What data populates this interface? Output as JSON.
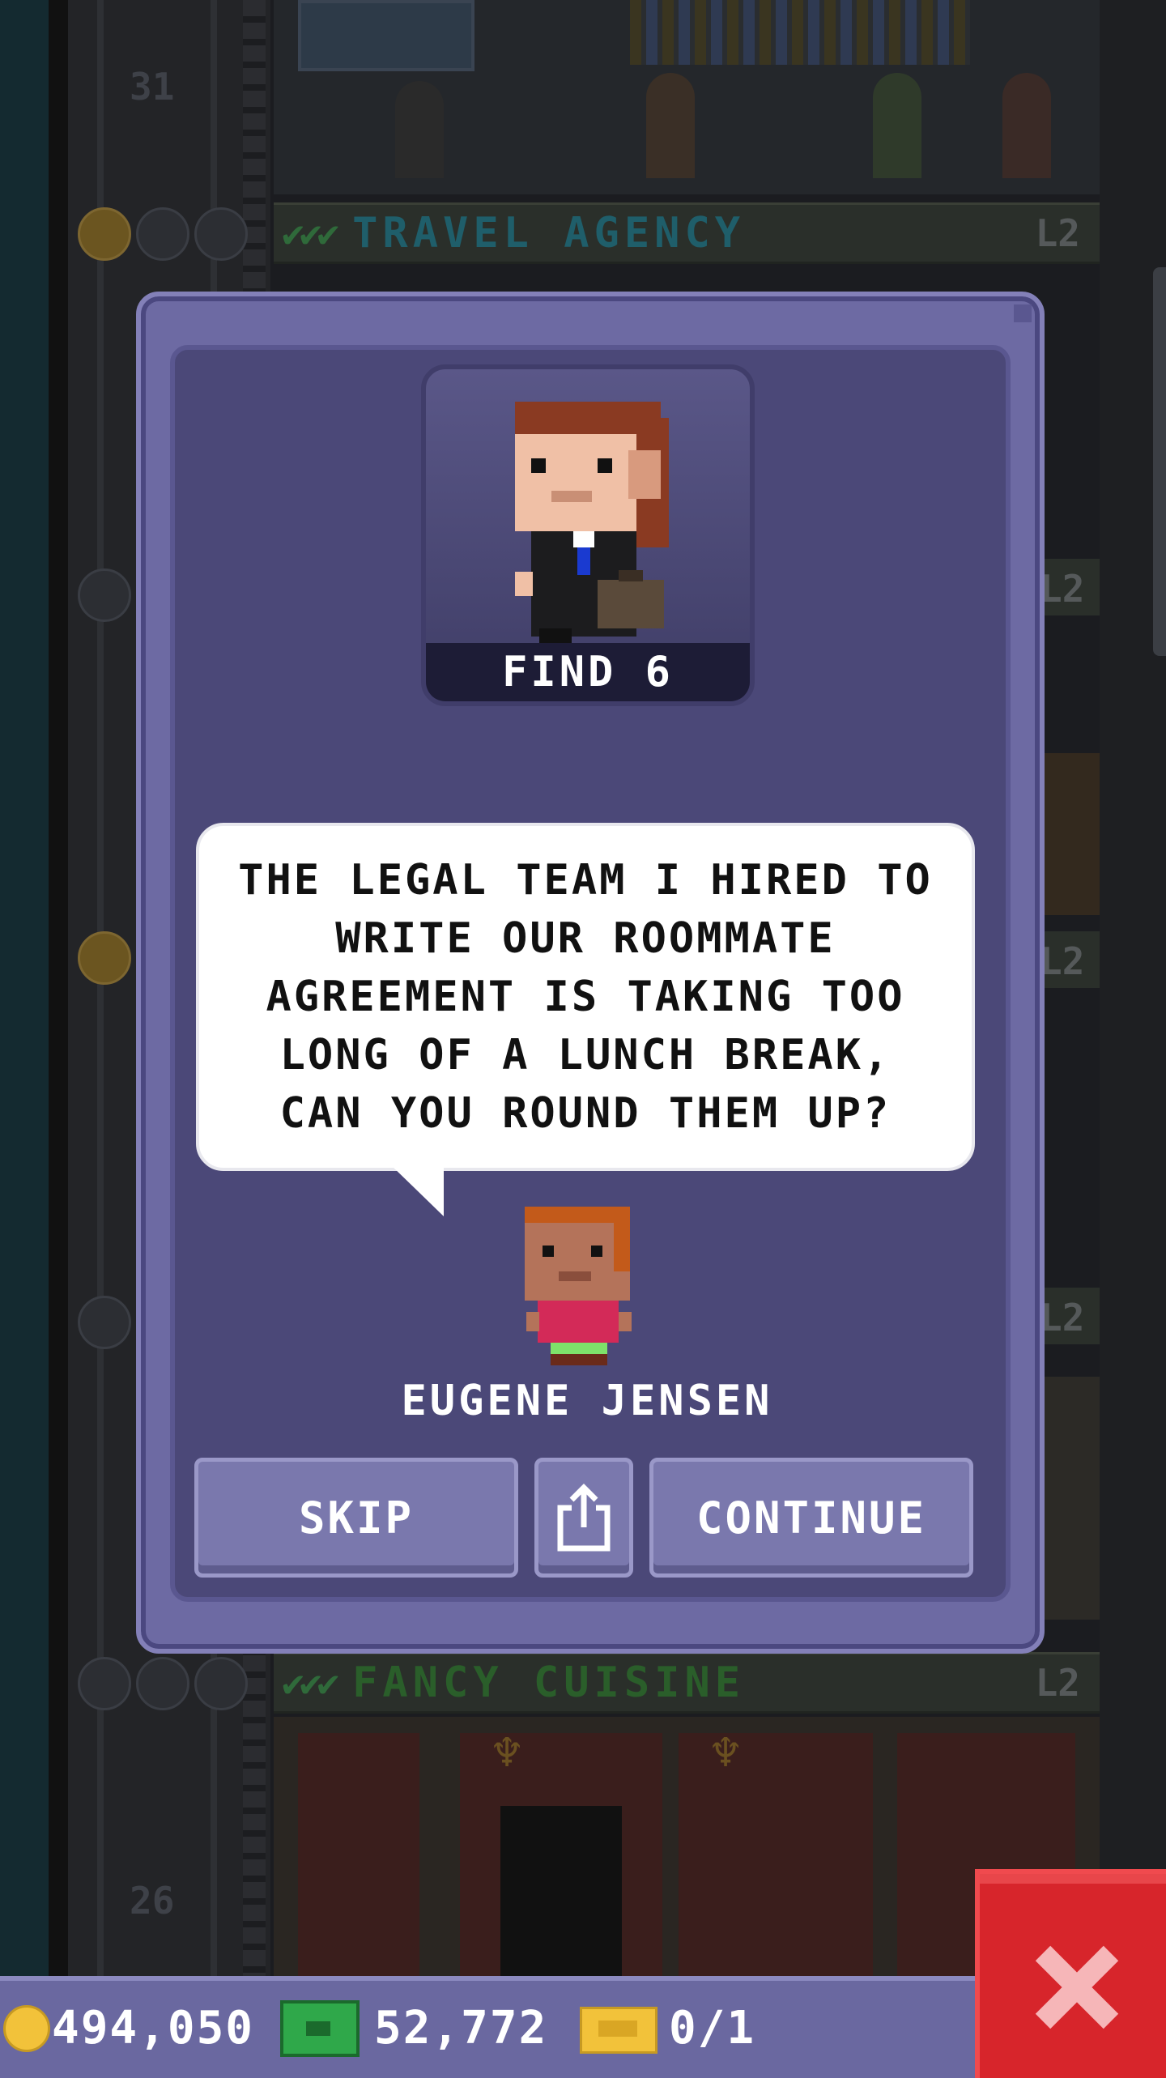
{
  "background": {
    "floors": [
      {
        "name": "TRAVEL AGENCY",
        "level": "L2",
        "number": "31"
      },
      {
        "name": "FANCY CUISINE",
        "level": "L2",
        "number": "26"
      }
    ],
    "side_levels": [
      "L2",
      "L2",
      "L2"
    ]
  },
  "dialog": {
    "portrait_label": "FIND 6",
    "message": "THE LEGAL TEAM I HIRED TO\nWRITE OUR ROOMMATE\nAGREEMENT IS TAKING TOO\nLONG OF A LUNCH BREAK,\nCAN YOU ROUND THEM UP?",
    "speaker_name": "EUGENE JENSEN",
    "buttons": {
      "skip": "SKIP",
      "share_icon": "share-icon",
      "continue": "CONTINUE"
    }
  },
  "status_bar": {
    "coins": "494,050",
    "bux": "52,772",
    "tickets": "0/1"
  },
  "colors": {
    "modal": "#6d6aa3",
    "modal_inner": "#4b4878",
    "button": "#7a78ad",
    "close": "#d7252b",
    "travel_agency": "#1f5e6a",
    "fancy_cuisine": "#2a5e2a"
  }
}
